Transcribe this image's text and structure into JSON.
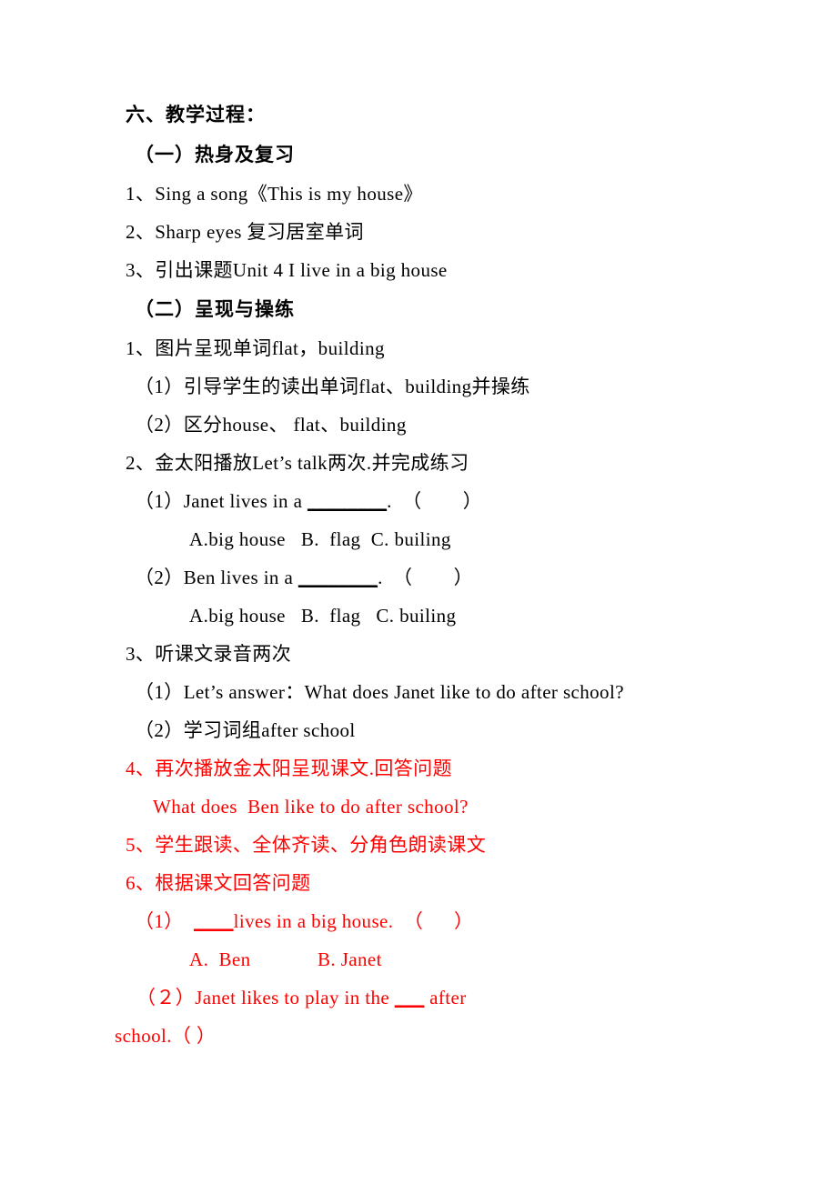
{
  "document": {
    "colors": {
      "text": "#000000",
      "highlight": "#ff0000",
      "background": "#ffffff"
    },
    "heading_main": "六、教学过程：",
    "sections": [
      {
        "heading": "（一）热身及复习",
        "items": [
          "1、Sing a song《This is my house》",
          "2、Sharp eyes 复习居室单词",
          "3、引出课题Unit 4 I live in a big house"
        ]
      },
      {
        "heading": "（二）呈现与操练",
        "items": [
          "1、图片呈现单词flat，building",
          "（1）引导学生的读出单词flat、building并操练",
          "（2）区分house、 flat、building",
          "2、金太阳播放Let’s talk两次.并完成练习"
        ]
      }
    ],
    "quiz_one": {
      "q1_prefix": "（1）Janet lives in a ",
      "q1_blank": "________",
      "q1_suffix": ".  （        ）",
      "q1_options": "A.big house   B.  flag  C. builing",
      "q2_prefix": "（2）Ben lives in a ",
      "q2_blank": "________",
      "q2_suffix": ".  （        ）",
      "q2_options": "A.big house   B.  flag   C. builing"
    },
    "listening": {
      "title": "3、听课文录音两次",
      "sub1": "（1）Let’s answer：What does Janet like to do after school?",
      "sub2": "（2）学习词组after school"
    },
    "red_section": {
      "item4": "4、再次播放金太阳呈现课文.回答问题",
      "item4_question": "What does  Ben like to do after school?",
      "item5": "5、学生跟读、全体齐读、分角色朗读课文",
      "item6": "6、根据课文回答问题",
      "q1_prefix": "（1）  ",
      "q1_blank": "____",
      "q1_suffix": "lives in a big house.  （      ）",
      "q1_options": "A.  Ben             B. Janet",
      "q2_body": "（２）Janet likes to play in the ",
      "q2_blank": "___",
      "q2_after": " after",
      "q2_tail": "school.（        ）"
    }
  }
}
